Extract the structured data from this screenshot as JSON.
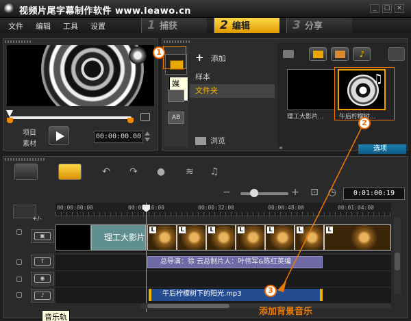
{
  "window": {
    "title": "视频片尾字幕制作软件 www.leawo.cn",
    "btn_min": "_",
    "btn_max": "□",
    "btn_close": "×"
  },
  "menu": {
    "items": [
      "文件",
      "编辑",
      "工具",
      "设置"
    ]
  },
  "steps": [
    {
      "num": "1",
      "label": "捕获"
    },
    {
      "num": "2",
      "label": "编辑"
    },
    {
      "num": "3",
      "label": "分享"
    }
  ],
  "preview": {
    "mode_project": "项目",
    "mode_clip": "素材",
    "timecode": "00:00:00.00"
  },
  "library": {
    "tooltip": "媒体",
    "add_label": "添加",
    "items": [
      "样本",
      "文件夹"
    ],
    "selected_index": 1,
    "browse_label": "浏览",
    "thumbs": [
      {
        "label": "理工大影片..."
      },
      {
        "label": "午后柠檬树..."
      }
    ],
    "options_label": "选项",
    "side_icon_ab": "AB"
  },
  "timeline": {
    "timecode": "0:01:00:19",
    "ruler_ticks": [
      "00:00:00:00",
      "00:00:16:00",
      "00:00:32:00",
      "00:00:48:00",
      "00:01:04:00"
    ],
    "title_card_text": "理工大影片",
    "title_clip_text": "总导演：徐 云总制片人：叶伟军&陈红英编",
    "audio_clip_text": "午后柠檬树下的阳光.mp3",
    "music_track_tooltip": "音乐轨",
    "track_menu": "+/-"
  },
  "annotations": {
    "badge1": "1",
    "badge2": "2",
    "badge3": "3",
    "caption": "添加背景音乐",
    "color": "#f07a00"
  }
}
